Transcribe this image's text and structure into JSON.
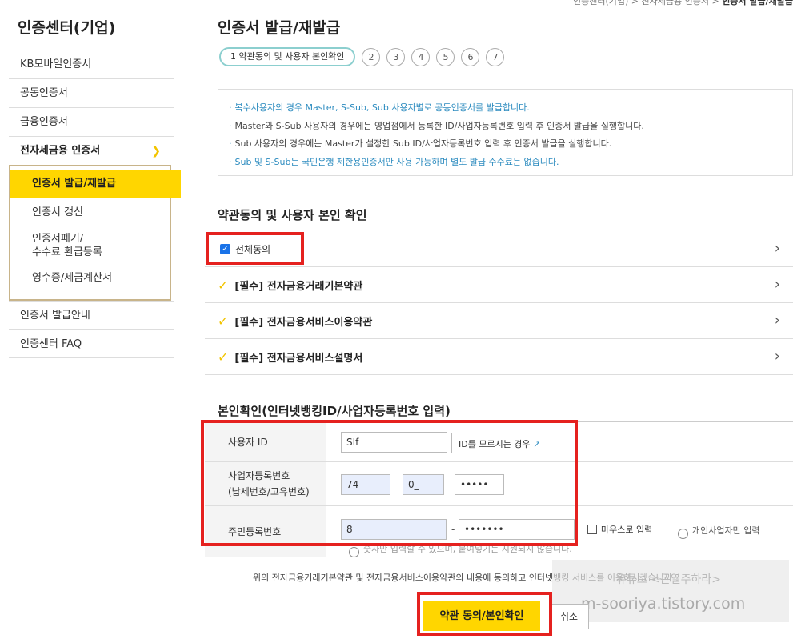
{
  "breadcrumb": {
    "a": "인증센터(기업)",
    "b": "전자세금용 인증서",
    "c": "인증서 발급/재발급"
  },
  "sidebar": {
    "title": "인증센터(기업)",
    "items": [
      "KB모바일인증서",
      "공동인증서",
      "금융인증서"
    ],
    "active": "전자세금용 인증서",
    "sub": {
      "selected": "인증서 발급/재발급",
      "renew": "인증서 갱신",
      "cancel_l1": "인증서폐기/",
      "cancel_l2": "수수료 환급등록",
      "receipt": "영수증/세금계산서"
    },
    "after": [
      "인증서 발급안내",
      "인증센터 FAQ"
    ]
  },
  "page_title": "인증서 발급/재발급",
  "steps": {
    "current": "1 약관동의 및 사용자 본인확인",
    "others": [
      "2",
      "3",
      "4",
      "5",
      "6",
      "7"
    ]
  },
  "notice": [
    "복수사용자의 경우 Master, S-Sub, Sub 사용자별로 공동인증서를 발급합니다.",
    "Master와 S-Sub 사용자의 경우에는 영업점에서 등록한 ID/사업자등록번호 입력 후 인증서 발급을 실행합니다.",
    "Sub 사용자의 경우에는 Master가 설정한 Sub ID/사업자등록번호 입력 후 인증서 발급을 실행합니다.",
    "Sub 및 S-Sub는 국민은행 제한용인증서만 사용 가능하며 별도 발급 수수료는 없습니다."
  ],
  "terms_heading": "약관동의 및 사용자 본인 확인",
  "terms": {
    "all": "전체동의",
    "items": [
      "[필수] 전자금융거래기본약관",
      "[필수] 전자금융서비스이용약관",
      "[필수] 전자금융서비스설명서"
    ]
  },
  "identity_heading": "본인확인(인터넷뱅킹ID/사업자등록번호 입력)",
  "form": {
    "user_id_label": "사용자 ID",
    "user_id_value": "SIf",
    "id_help_button": "ID를 모르시는 경우",
    "biz_label_1": "사업자등록번호",
    "biz_label_2": "(납세번호/고유번호)",
    "biz_1": "74",
    "biz_2": "0_",
    "biz_3": "•••••",
    "rrn_label": "주민등록번호",
    "rrn_1": "8",
    "rrn_2": "•••••••",
    "mouse_input": "마우스로 입력",
    "individual_only": "개인사업자만 입력",
    "hint": "숫자만 입력할 수 있으며, 붙여넣기는 지원되지 않습니다."
  },
  "question": "위의 전자금융거래기본약관 및 전자금융서비스이용약관의 내용에 동의하고 인터넷뱅킹 서비스를 이용하시겠습니까 ?",
  "buttons": {
    "confirm": "약관 동의/본인확인",
    "cancel": "취소"
  },
  "watermark": {
    "line1": "유튜브 <돈일주하라>",
    "line2": "m-sooriya.tistory.com"
  },
  "colors": {
    "accent": "#ffd600",
    "highlight_box": "#e5211f",
    "notice_blue": "#2b8bbf",
    "step_outline": "#8ccfcf"
  }
}
